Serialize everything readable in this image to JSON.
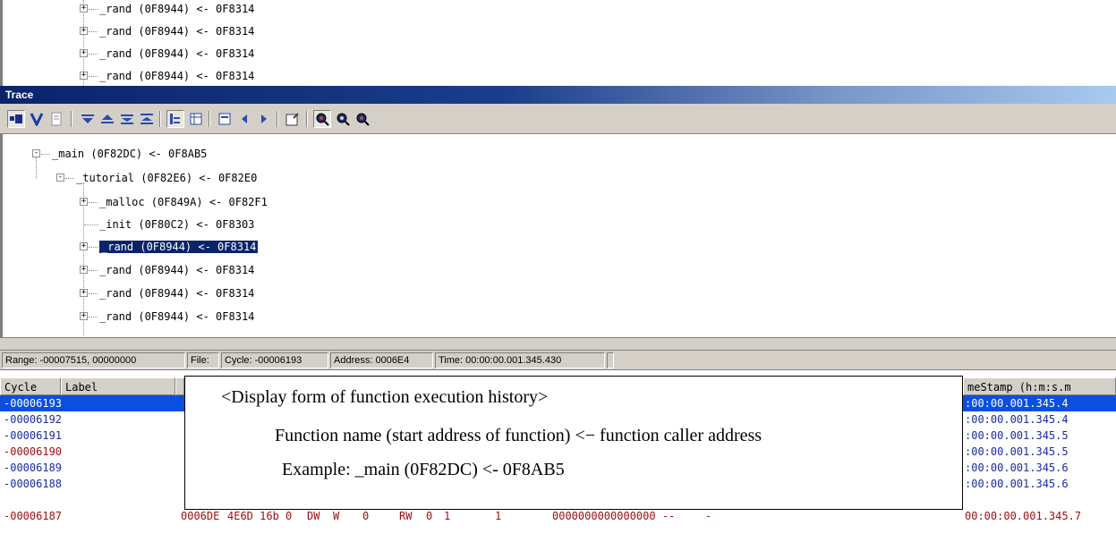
{
  "top_tree": {
    "rows": [
      {
        "text": "_rand (0F8944) <- 0F8314",
        "expander": "+"
      },
      {
        "text": "_rand (0F8944) <- 0F8314",
        "expander": "+"
      },
      {
        "text": "_rand (0F8944) <- 0F8314",
        "expander": "+"
      },
      {
        "text": "_rand (0F8944) <- 0F8314",
        "expander": "+"
      }
    ]
  },
  "window": {
    "title": "Trace"
  },
  "toolbar": {
    "buttons": [
      {
        "icon": "record-icon"
      },
      {
        "icon": "filter-icon"
      },
      {
        "icon": "document-icon"
      },
      {
        "icon": "scroll-down-icon"
      },
      {
        "icon": "scroll-up-icon"
      },
      {
        "icon": "jump-bottom-icon"
      },
      {
        "icon": "jump-top-icon"
      },
      {
        "icon": "tree-view-icon"
      },
      {
        "icon": "list-view-icon"
      },
      {
        "icon": "window-icon"
      },
      {
        "icon": "prev-icon"
      },
      {
        "icon": "next-icon"
      },
      {
        "icon": "properties-icon"
      },
      {
        "icon": "find-icon"
      },
      {
        "icon": "find-next-icon"
      },
      {
        "icon": "find-prev-icon"
      }
    ]
  },
  "trace_tree": {
    "rows": [
      {
        "text": "_main (0F82DC) <- 0F8AB5",
        "expander": "-"
      },
      {
        "text": "_tutorial (0F82E6) <- 0F82E0",
        "expander": "-"
      },
      {
        "text": "_malloc (0F849A) <- 0F82F1",
        "expander": "+"
      },
      {
        "text": "_init (0F80C2) <- 0F8303",
        "expander": ""
      },
      {
        "text": "_rand (0F8944) <- 0F8314",
        "expander": "+",
        "selected": true
      },
      {
        "text": "_rand (0F8944) <- 0F8314",
        "expander": "+"
      },
      {
        "text": "_rand (0F8944) <- 0F8314",
        "expander": "+"
      },
      {
        "text": "_rand (0F8944) <- 0F8314",
        "expander": "+"
      }
    ]
  },
  "status": {
    "range": "Range: -00007515, 00000000",
    "file": "File:",
    "cycle": "Cycle: -00006193",
    "address": "Address: 0006E4",
    "time": "Time: 00:00:00.001.345.430"
  },
  "list": {
    "headers": {
      "cycle": "Cycle",
      "label": "Label",
      "timestamp": "meStamp (h:m:s.m"
    },
    "rows": [
      {
        "cycle": "-00006193",
        "ts": ":00:00.001.345.4",
        "selected": true
      },
      {
        "cycle": "-00006192",
        "ts": ":00:00.001.345.4"
      },
      {
        "cycle": "-00006191",
        "ts": ":00:00.001.345.5"
      },
      {
        "cycle": "-00006190",
        "ts": ":00:00.001.345.5"
      },
      {
        "cycle": "-00006189",
        "ts": ":00:00.001.345.6"
      },
      {
        "cycle": "-00006188",
        "ts": ":00:00.001.345.6"
      },
      {
        "cycle": "-00006187",
        "addr": "0006DE",
        "data": "4E6D 16b 0",
        "dw": "DW",
        "w": "W",
        "z": "0",
        "rw": "RW",
        "a": "0",
        "b": "1",
        "one": "1",
        "bits": "0000000000000000 --",
        "dash": "-",
        "ts": "00:00:00.001.345.7"
      }
    ]
  },
  "annotation": {
    "heading": "<Display form of function execution history>",
    "line1": "Function name (start address of function) <− function caller address",
    "line2": "Example: _main (0F82DC) <- 0F8AB5"
  }
}
